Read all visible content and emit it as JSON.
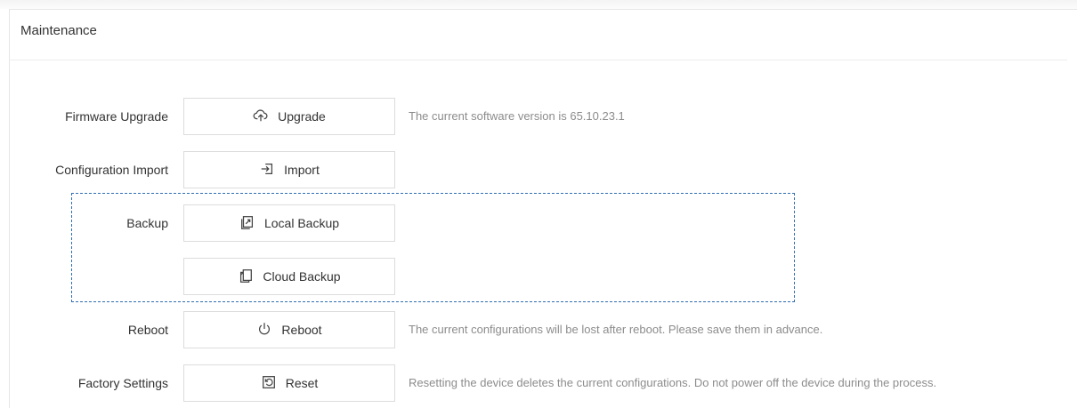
{
  "page": {
    "title": "Maintenance"
  },
  "rows": [
    {
      "label": "Firmware Upgrade",
      "button": "Upgrade",
      "icon": "cloud-upload-icon",
      "description": "The current software version is 65.10.23.1"
    },
    {
      "label": "Configuration Import",
      "button": "Import",
      "icon": "import-icon",
      "description": ""
    },
    {
      "label": "Backup",
      "button": "Local Backup",
      "icon": "local-backup-icon",
      "description": ""
    },
    {
      "label": "",
      "button": "Cloud Backup",
      "icon": "cloud-backup-icon",
      "description": ""
    },
    {
      "label": "Reboot",
      "button": "Reboot",
      "icon": "power-icon",
      "description": "The current configurations will be lost after reboot. Please save them in advance."
    },
    {
      "label": "Factory Settings",
      "button": "Reset",
      "icon": "reset-icon",
      "description": "Resetting the device deletes the current configurations. Do not power off the device during the process."
    }
  ],
  "colors": {
    "highlight_border": "#2f6fb5",
    "description_text": "#8c8c8c",
    "button_border": "#dcdcdc"
  }
}
